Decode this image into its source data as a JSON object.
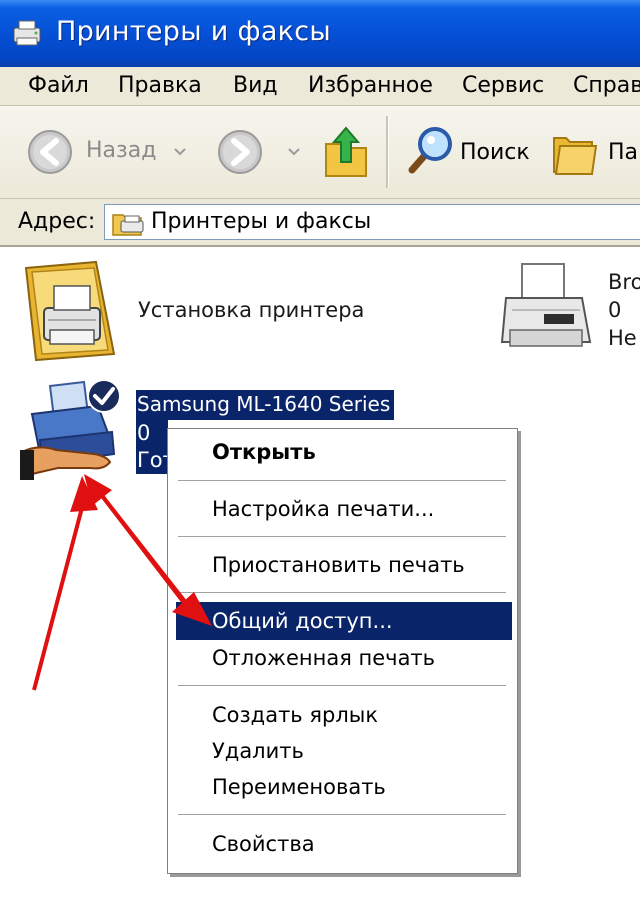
{
  "window": {
    "title": "Принтеры и факсы",
    "title_icon": "printer-folder-icon"
  },
  "menubar": {
    "items": [
      "Файл",
      "Правка",
      "Вид",
      "Избранное",
      "Сервис",
      "Справ"
    ]
  },
  "toolbar": {
    "back_label": "Назад",
    "search_label": "Поиск",
    "folders_label": "Па"
  },
  "address": {
    "label": "Адрес:",
    "value": "Принтеры и факсы"
  },
  "content": {
    "add_printer": {
      "label": "Установка принтера"
    },
    "broadcast_printer": {
      "name": "Bro",
      "docs": "0",
      "status": "Не"
    },
    "samsung_printer": {
      "name": "Samsung ML-1640 Series",
      "docs": "0",
      "status": "Гот",
      "default": true
    }
  },
  "context_menu": {
    "open": "Открыть",
    "print_settings": "Настройка печати...",
    "pause": "Приостановить печать",
    "sharing": "Общий доступ...",
    "deferred": "Отложенная печать",
    "shortcut": "Создать ярлык",
    "delete": "Удалить",
    "rename": "Переименовать",
    "properties": "Свойства",
    "highlighted": "Общий доступ..."
  },
  "colors": {
    "titlebar": "#0550d6",
    "selection": "#0a246a",
    "annotation_arrow": "#e01010"
  }
}
